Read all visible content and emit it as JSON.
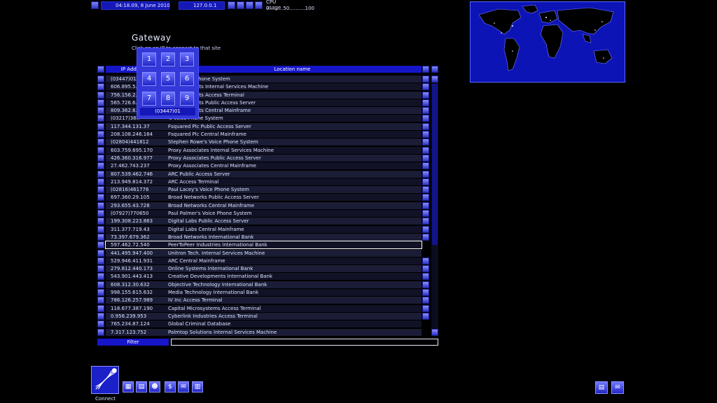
{
  "topbar": {
    "datetime": "04:18.09, 8 June 2010",
    "ip": "127.0.0.1",
    "cpu_label": "CPU usage",
    "cpu_scale": "0.........50..........100"
  },
  "gateway": {
    "title": "Gateway",
    "subtitle": "Click on an IP to connect to that site"
  },
  "keypad": {
    "keys": [
      "1",
      "2",
      "3",
      "4",
      "5",
      "6",
      "7",
      "8",
      "9"
    ],
    "readout": "(03447)01"
  },
  "table": {
    "col_ip": "IP Address",
    "col_location": "Location name",
    "selected_index": 21,
    "rows": [
      {
        "ip": "(03447)01",
        "location": "Ice's Voice Phone System"
      },
      {
        "ip": "606.895.5..",
        "location": "Developments Internal Services Machine"
      },
      {
        "ip": "756.156.2..",
        "location": "Developments Access Terminal"
      },
      {
        "ip": "565.726.6..",
        "location": "Developments Public Access Server"
      },
      {
        "ip": "809.362.6..",
        "location": "Developments Central Mainframe"
      },
      {
        "ip": "(03217)38..",
        "location": "'s Voice Phone System"
      },
      {
        "ip": "117.344.131.37",
        "location": "Fsquared Plc Public Access Server"
      },
      {
        "ip": "208.108.246.164",
        "location": "Fsquared Plc Central Mainframe"
      },
      {
        "ip": "(02804)441812",
        "location": "Stephen Rowe's Voice Phone System"
      },
      {
        "ip": "603.759.695.170",
        "location": "Proxy Associates Internal Services Machine"
      },
      {
        "ip": "426.360.316.977",
        "location": "Proxy Associates Public Access Server"
      },
      {
        "ip": "27.462.743.237",
        "location": "Proxy Associates Central Mainframe"
      },
      {
        "ip": "807.539.462.746",
        "location": "ARC Public Access Server"
      },
      {
        "ip": "213.949.814.372",
        "location": "ARC Access Terminal"
      },
      {
        "ip": "(02816)461776",
        "location": "Paul Lacey's Voice Phone System"
      },
      {
        "ip": "697.360.29.105",
        "location": "Broad Networks Public Access Server"
      },
      {
        "ip": "293.655.43.728",
        "location": "Broad Networks Central Mainframe"
      },
      {
        "ip": "(07927)770650",
        "location": "Paul Palmer's Voice Phone System"
      },
      {
        "ip": "199.308.223.863",
        "location": "Digital Labs Public Access Server"
      },
      {
        "ip": "311.377.719.43",
        "location": "Digital Labs Central Mainframe"
      },
      {
        "ip": "73.397.679.362",
        "location": "Broad Networks International Bank"
      },
      {
        "ip": "597.462.72.540",
        "location": "PeerToPeer Industries International Bank"
      },
      {
        "ip": "441.495.947.400",
        "location": "Unitron Tech. Internal Services Machine"
      },
      {
        "ip": "529.946.411.931",
        "location": "ARC Central Mainframe"
      },
      {
        "ip": "279.812.440.173",
        "location": "Online Systems International Bank"
      },
      {
        "ip": "543.901.443.413",
        "location": "Creative Developments International Bank"
      },
      {
        "ip": "608.312.30.632",
        "location": "Objective Technology International Bank"
      },
      {
        "ip": "998.155.615.632",
        "location": "Media Technology International Bank"
      },
      {
        "ip": "786.126.257.989",
        "location": "IV Inc Access Terminal"
      },
      {
        "ip": "118.677.387.190",
        "location": "Capital Microsystems Access Terminal"
      },
      {
        "ip": "0.956.239.953",
        "location": "Cyberlink Industries Access Terminal"
      },
      {
        "ip": "765.234.87.124",
        "location": "Global Criminal Database"
      },
      {
        "ip": "7.317.123.752",
        "location": "Palmtop Solutions Internal Services Machine"
      }
    ]
  },
  "filter": {
    "label": "Filter",
    "value": ""
  },
  "bottom": {
    "connect_label": "Connect"
  }
}
